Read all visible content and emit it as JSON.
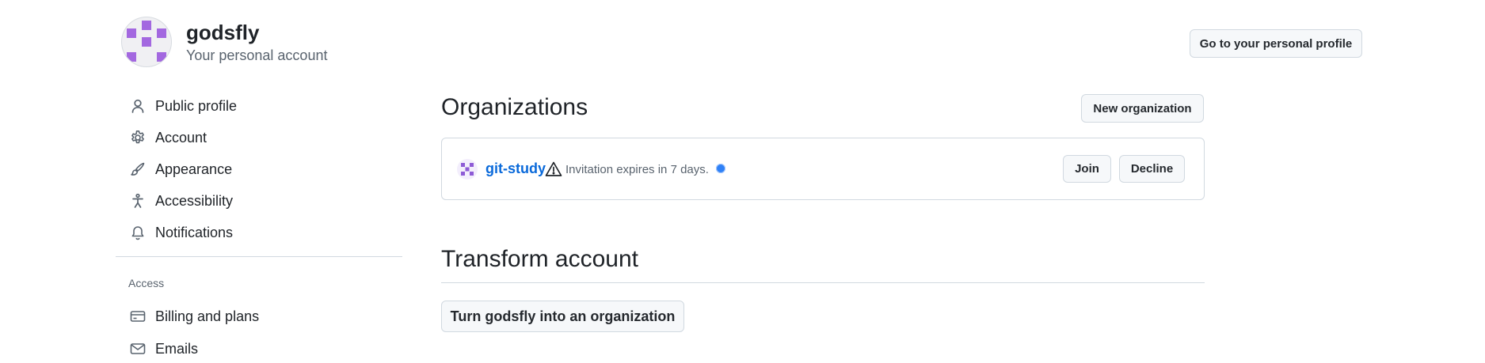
{
  "header": {
    "username": "godsfly",
    "subtitle": "Your personal account",
    "profile_button": "Go to your personal profile"
  },
  "sidebar": {
    "items": [
      {
        "label": "Public profile",
        "icon": "person-icon"
      },
      {
        "label": "Account",
        "icon": "gear-icon"
      },
      {
        "label": "Appearance",
        "icon": "paintbrush-icon"
      },
      {
        "label": "Accessibility",
        "icon": "accessibility-icon"
      },
      {
        "label": "Notifications",
        "icon": "bell-icon"
      }
    ],
    "access_heading": "Access",
    "access_items": [
      {
        "label": "Billing and plans",
        "icon": "credit-card-icon"
      },
      {
        "label": "Emails",
        "icon": "mail-icon"
      }
    ]
  },
  "organizations": {
    "title": "Organizations",
    "new_button": "New organization",
    "invites": [
      {
        "name": "git-study",
        "status": "Invitation expires in 7 days.",
        "join_label": "Join",
        "decline_label": "Decline"
      }
    ]
  },
  "transform": {
    "title": "Transform account",
    "button": "Turn godsfly into an organization"
  },
  "colors": {
    "link": "#0969da",
    "avatar_accent": "#a368e0",
    "dot": "#2f81f7"
  }
}
